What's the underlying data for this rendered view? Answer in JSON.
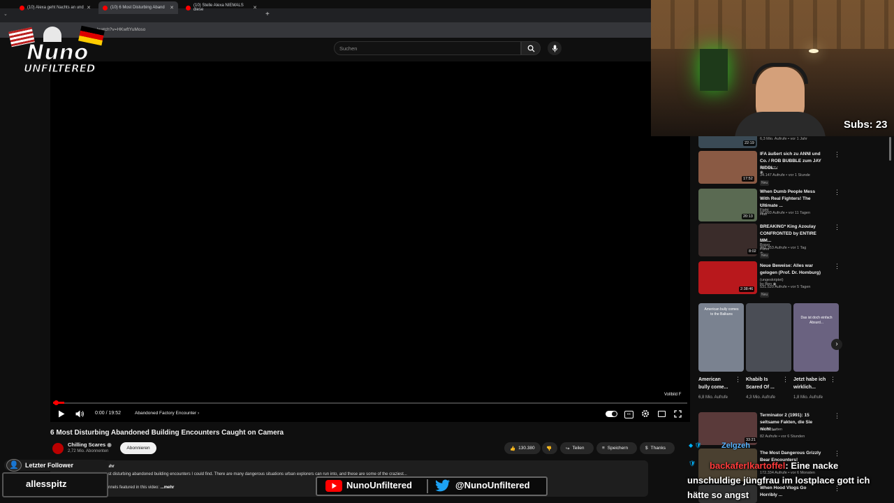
{
  "browser": {
    "tabs": [
      {
        "label": "(10) Alexa geht Nachts an und",
        "active": false
      },
      {
        "label": "(10) 6 Most Disturbing Aband",
        "active": true
      },
      {
        "label": "(10) Stelle Alexa NIEMALS diese",
        "active": false
      }
    ],
    "url": "/watch?v=HKwftYuMoso"
  },
  "youtube": {
    "search_placeholder": "Suchen"
  },
  "player": {
    "time": "0:00 / 19:52",
    "chapter": "Abandoned Factory Encounter",
    "fullscreen_hint": "Vollbild",
    "fullscreen_key": "F",
    "progress_fraction": 0.002
  },
  "video": {
    "title": "6 Most Disturbing Abandoned Building Encounters Caught on Camera",
    "channel": "Chilling Scares",
    "subscribers": "2,72 Mio. Abonnenten",
    "subscribe_label": "Abonnieren",
    "likes": "130.380",
    "share_label": "Teilen",
    "save_label": "Speichern",
    "thanks_label": "Thanks",
    "desc_meta": "Jahr",
    "desc_line1": "st disturbing abandoned building encounters I could find. There are many dangerous situations urban explorers can run into, and these are some of the craziest...",
    "desc_line2": "nnels featured in this video:",
    "desc_more": "...mehr"
  },
  "recommendations": [
    {
      "title": "",
      "channel": "",
      "meta": "6,3 Mio. Aufrufe • vor 1 Jahr",
      "duration": "22:19",
      "thumb_color": "#3a4a55",
      "badge": ""
    },
    {
      "title": "IFA äußert sich zu ANNI und Co. / ROB BUBBLE zum JAY RIDDL...",
      "channel": "KuchenTV",
      "meta": "34.147 Aufrufe • vor 1 Stunde",
      "duration": "17:52",
      "thumb_color": "#8a5a44",
      "badge": "Neu"
    },
    {
      "title": "When Dumb People Mess With Real Fighters! The Ultimate ...",
      "channel": "The Fight Hub",
      "meta": "91.993 Aufrufe • vor 11 Tagen",
      "duration": "20:13",
      "thumb_color": "#5a6a52",
      "badge": ""
    },
    {
      "title": "BREAKING* King Azoulay CONFRONTED by ENTIRE MM...",
      "channel": "Jon Bravo Films",
      "meta": "302.353 Aufrufe • vor 1 Tag",
      "duration": "8:02",
      "thumb_color": "#3a2c2a",
      "badge": "Neu"
    },
    {
      "title": "Neue Beweise: Alles war gelogen (Prof. Dr. Homburg)",
      "channel": "(ungeskriptet) by Ben",
      "meta": "531.520 Aufrufe • vor 5 Tagen",
      "duration": "2:38:46",
      "thumb_color": "#b8181c",
      "badge": "Neu"
    }
  ],
  "shorts": [
    {
      "title": "American bully come...",
      "views": "6,8 Mio. Aufrufe",
      "overlay": "American bully comes to the Balkans",
      "thumb_color": "#7a8290"
    },
    {
      "title": "Khabib Is Scared Of ...",
      "views": "4,3 Mio. Aufrufe",
      "overlay": "",
      "thumb_color": "#4a4d55"
    },
    {
      "title": "Jetzt habe ich wirklich...",
      "views": "1,8 Mio. Aufrufe",
      "overlay": "Das ist doch einfach Absurd...",
      "thumb_color": "#6a6280"
    }
  ],
  "recommendations_lower": [
    {
      "title": "Terminator 2 (1991): 15 seltsame Fakten, die Sie nicht ...",
      "channel": "FilmSchatten",
      "meta": "82 Aufrufe • vor 6 Stunden",
      "duration": "33:21",
      "thumb_color": "#5a3a3a"
    },
    {
      "title": "The Most Dangerous Grizzly Bear Encounters!",
      "channel": "",
      "meta": "172.334 Aufrufe • vor 6 Monaten",
      "duration": "",
      "thumb_color": "#4a4030"
    },
    {
      "title": "When Hood Vlogs Go Horribly ...",
      "channel": "",
      "meta": "",
      "duration": "",
      "thumb_color": "#303030"
    }
  ],
  "stream": {
    "logo_line1": "Nuno",
    "logo_line2": "UNFILTERED",
    "subs_counter": "Subs: 23",
    "follower_label": "Letzter Follower",
    "follower_name": "allesspitz",
    "youtube_handle": "NunoUnfiltered",
    "twitter_handle": "@NunoUnfiltered",
    "chat": [
      {
        "user": "Zelgzeh",
        "message": ""
      },
      {
        "user": "backaferlkartoffel",
        "message": ": Eine nacke unschuldige jüngfrau im lostplace gott ich hätte so angst"
      }
    ]
  }
}
